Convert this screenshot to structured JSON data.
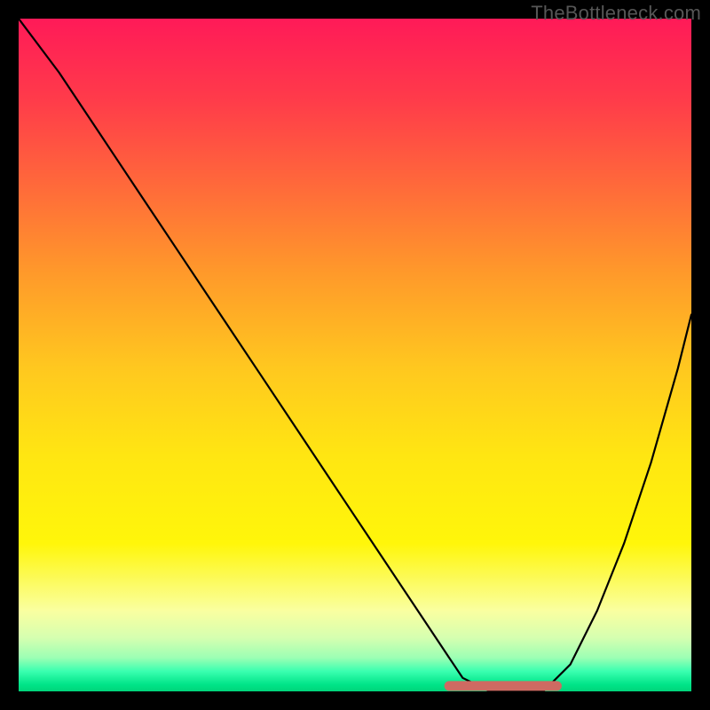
{
  "watermark": "TheBottleneck.com",
  "chart_data": {
    "type": "line",
    "title": "",
    "xlabel": "",
    "ylabel": "",
    "xlim": [
      0,
      100
    ],
    "ylim": [
      0,
      100
    ],
    "series": [
      {
        "name": "curve",
        "x": [
          0,
          6,
          12,
          18,
          24,
          30,
          36,
          42,
          48,
          54,
          60,
          64,
          66,
          68,
          70,
          74,
          78,
          82,
          86,
          90,
          94,
          98,
          100
        ],
        "values": [
          100,
          92,
          83,
          74,
          65,
          56,
          47,
          38,
          29,
          20,
          11,
          5,
          2,
          1,
          0,
          0,
          0,
          4,
          12,
          22,
          34,
          48,
          56
        ]
      }
    ],
    "flat_region": {
      "x_start": 64,
      "x_end": 80,
      "y": 0.8
    },
    "marker_color": "#cf6a62",
    "curve_color": "#000000",
    "background_gradient": [
      "#ff1a58",
      "#ffe612",
      "#00d47a"
    ]
  }
}
